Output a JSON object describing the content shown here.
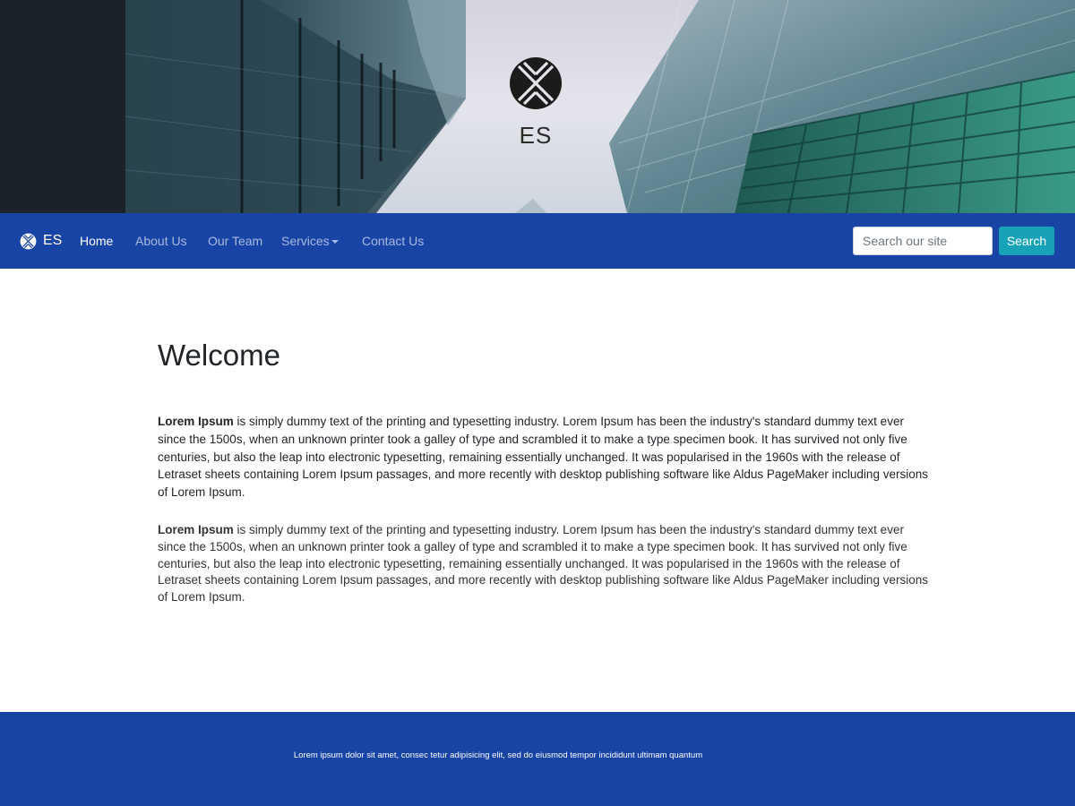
{
  "hero": {
    "logo_icon": "es-logo-icon",
    "title": "ES"
  },
  "navbar": {
    "brand": {
      "icon": "es-logo-icon",
      "text": "ES"
    },
    "links": [
      {
        "label": "Home",
        "active": true
      },
      {
        "label": "About Us",
        "active": false
      },
      {
        "label": "Our Team",
        "active": false
      },
      {
        "label": "Services",
        "active": false,
        "dropdown": true
      },
      {
        "label": "Contact Us",
        "active": false
      }
    ],
    "search": {
      "placeholder": "Search our site",
      "value": "",
      "button_label": "Search"
    },
    "colors": {
      "background": "#1844a6",
      "button": "#17a2b8"
    }
  },
  "main": {
    "heading": "Welcome",
    "paragraphs": [
      {
        "bold": "Lorem Ipsum",
        "text": " is simply dummy text of the printing and typesetting industry. Lorem Ipsum has been the industry's standard dummy text ever since the 1500s, when an unknown printer took a galley of type and scrambled it to make a type specimen book. It has survived not only five centuries, but also the leap into electronic typesetting, remaining essentially unchanged. It was popularised in the 1960s with the release of Letraset sheets containing Lorem Ipsum passages, and more recently with desktop publishing software like Aldus PageMaker including versions of Lorem Ipsum."
      },
      {
        "bold": "Lorem Ipsum",
        "text": " is simply dummy text of the printing and typesetting industry. Lorem Ipsum has been the industry's standard dummy text ever since the 1500s, when an unknown printer took a galley of type and scrambled it to make a type specimen book. It has survived not only five centuries, but also the leap into electronic typesetting, remaining essentially unchanged. It was popularised in the 1960s with the release of Letraset sheets containing Lorem Ipsum passages, and more recently with desktop publishing software like Aldus PageMaker including versions of Lorem Ipsum."
      }
    ]
  },
  "footer": {
    "text": "Lorem ipsum dolor sit amet, consec tetur adipisicing elit, sed do eiusmod tempor incididunt ultimam quantum"
  }
}
